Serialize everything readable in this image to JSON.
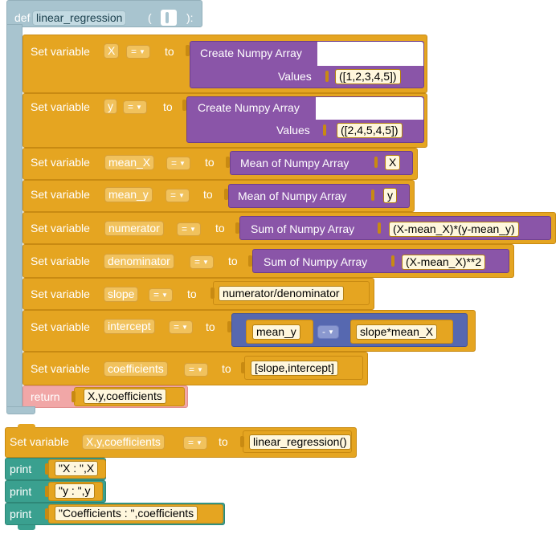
{
  "func": {
    "def_keyword": "def",
    "name": "linear_regression",
    "paren_open": "(",
    "paren_close": "):",
    "return_keyword": "return",
    "return_value": "X,y,coefficients"
  },
  "labels": {
    "set_variable": "Set variable",
    "to": "to",
    "eq": "=",
    "create_numpy": "Create Numpy Array",
    "values": "Values",
    "mean_numpy": "Mean of Numpy Array",
    "sum_numpy": "Sum of Numpy Array",
    "print": "print",
    "minus": "-"
  },
  "rows": [
    {
      "var": "X",
      "value": "([1,2,3,4,5])"
    },
    {
      "var": "y",
      "value": "([2,4,5,4,5])"
    },
    {
      "var": "mean_X",
      "value": "X"
    },
    {
      "var": "mean_y",
      "value": "y"
    },
    {
      "var": "numerator",
      "value": "(X-mean_X)*(y-mean_y)"
    },
    {
      "var": "denominator",
      "value": "(X-mean_X)**2"
    },
    {
      "var": "slope",
      "value": "numerator/denominator"
    },
    {
      "var": "intercept",
      "left": "mean_y",
      "right": "slope*mean_X"
    },
    {
      "var": "coefficients",
      "value": "[slope,intercept]"
    }
  ],
  "main": {
    "set_var": "X,y,coefficients",
    "call": "linear_regression()",
    "prints": [
      "\"X : \",X",
      "\"y : \",y",
      "\"Coefficients : \",coefficients"
    ]
  },
  "colors": {
    "def_block": "#a8c4cf",
    "set_block": "#e5a521",
    "numpy_block": "#8a55a8",
    "operator_block": "#5668b0",
    "return_block": "#f1a7a7",
    "print_block": "#3aa08f"
  }
}
